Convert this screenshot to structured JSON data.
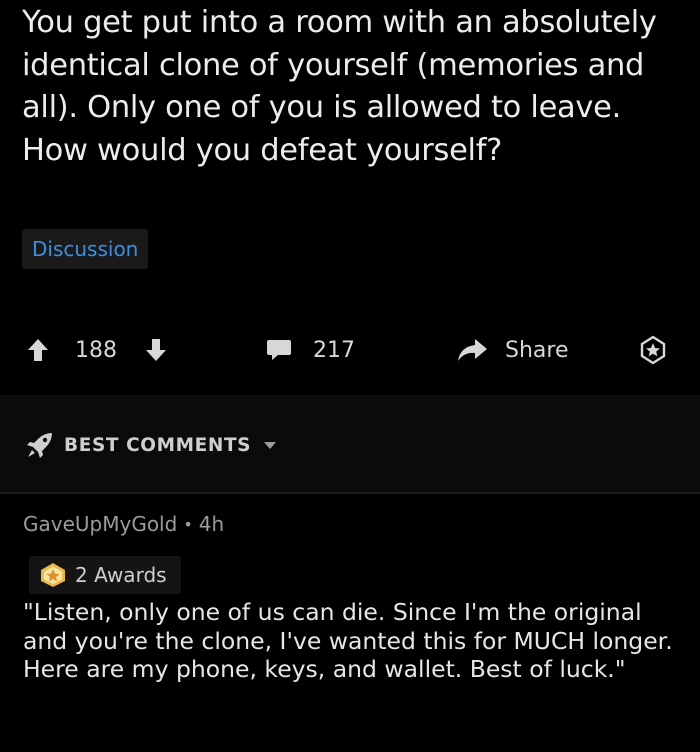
{
  "post": {
    "title": "You get put into a room with an absolutely identical clone of yourself (memories and all). Only one of you is allowed to leave. How would you defeat yourself?",
    "flair": "Discussion"
  },
  "actions": {
    "upvote_icon": "upvote-arrow-icon",
    "score": "188",
    "downvote_icon": "downvote-arrow-icon",
    "comment_icon": "comment-bubble-icon",
    "comments_count": "217",
    "share_icon": "share-arrow-icon",
    "share_label": "Share",
    "award_icon": "award-icon"
  },
  "sort": {
    "icon": "rocket-icon",
    "label": "BEST COMMENTS",
    "chevron_icon": "chevron-down-icon"
  },
  "comment": {
    "author": "GaveUpMyGold",
    "separator": "•",
    "age": "4h",
    "awards_icon": "award-icon",
    "awards_label": "2 Awards",
    "body": "\"Listen, only one of us can die. Since I'm the original and you're the clone, I've wanted this for MUCH longer. Here are my phone, keys, and wallet. Best of luck.\""
  },
  "colors": {
    "background": "#000000",
    "text": "#e8e8e8",
    "flair_text": "#3d8fe0",
    "muted": "#9b9b9b",
    "award_gold": "#e8b84a"
  }
}
